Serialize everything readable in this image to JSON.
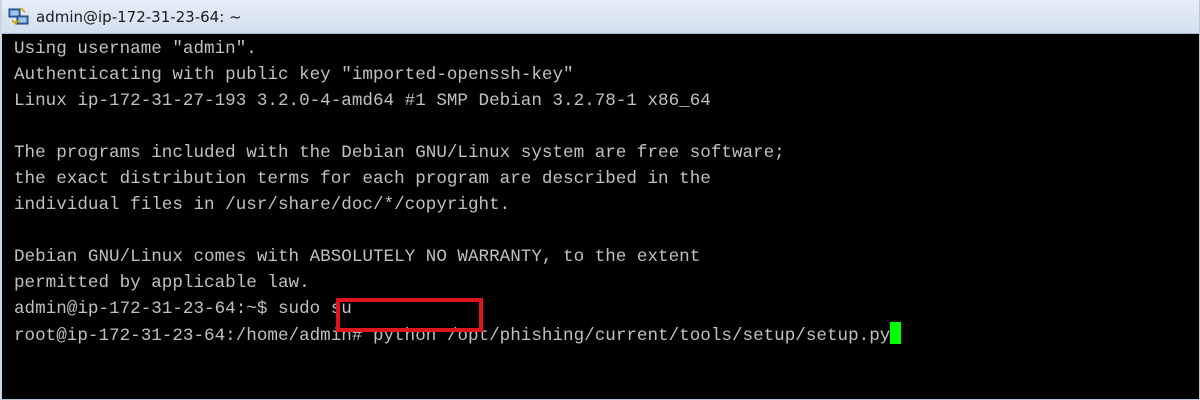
{
  "window": {
    "title": "admin@ip-172-31-23-64: ~",
    "icon": "putty-icon"
  },
  "terminal": {
    "lines": [
      "Using username \"admin\".",
      "Authenticating with public key \"imported-openssh-key\"",
      "Linux ip-172-31-27-193 3.2.0-4-amd64 #1 SMP Debian 3.2.78-1 x86_64",
      "",
      "The programs included with the Debian GNU/Linux system are free software;",
      "the exact distribution terms for each program are described in the",
      "individual files in /usr/share/doc/*/copyright.",
      "",
      "Debian GNU/Linux comes with ABSOLUTELY NO WARRANTY, to the extent",
      "permitted by applicable law."
    ],
    "prompt1": {
      "prompt": "admin@ip-172-31-23-64:~$",
      "command": " sudo su"
    },
    "prompt2": {
      "prompt": "root@ip-172-31-23-64:/home/admin#",
      "command": " python /opt/phishing/current/tools/setup/setup.py"
    },
    "colors": {
      "background": "#000000",
      "text": "#c0c0c0",
      "cursor": "#00ff00",
      "highlight": "#e0141e"
    }
  }
}
